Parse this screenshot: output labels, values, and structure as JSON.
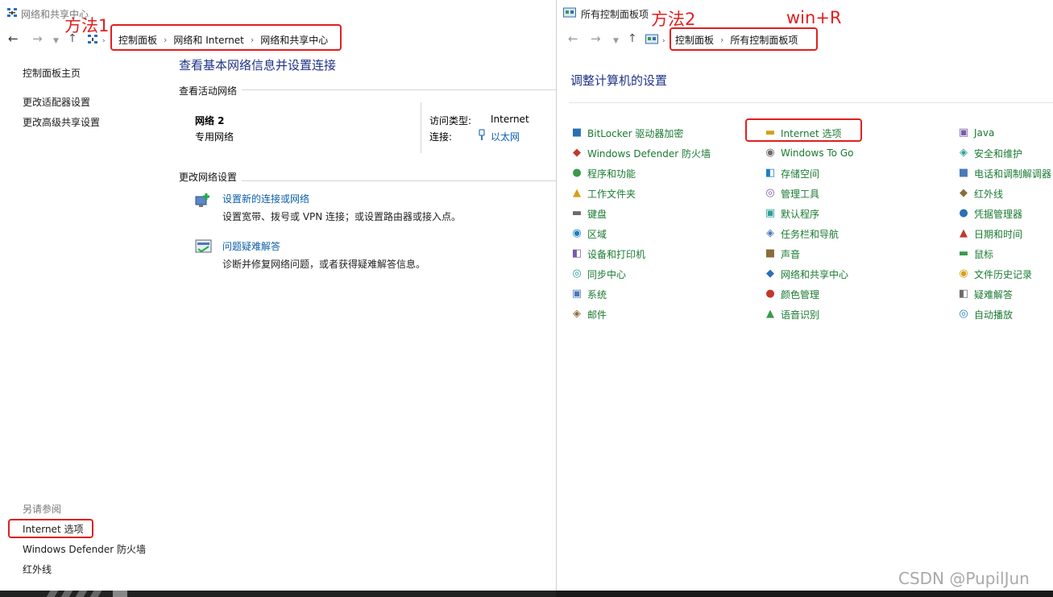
{
  "left_window": {
    "title": "网络和共享中心",
    "breadcrumb": [
      "控制面板",
      "网络和 Internet",
      "网络和共享中心"
    ],
    "annotation": "方法1",
    "sidebar": {
      "home": "控制面板主页",
      "links": [
        "更改适配器设置",
        "更改高级共享设置"
      ],
      "see_also_label": "另请参阅",
      "see_also": [
        "Internet 选项",
        "Windows Defender 防火墙",
        "红外线"
      ]
    },
    "main": {
      "heading": "查看基本网络信息并设置连接",
      "active_section": "查看活动网络",
      "network_name": "网络 2",
      "network_type": "专用网络",
      "access_type_label": "访问类型:",
      "access_type_value": "Internet",
      "connection_label": "连接:",
      "connection_value": "以太网",
      "change_section": "更改网络设置",
      "tasks": [
        {
          "title": "设置新的连接或网络",
          "desc": "设置宽带、拨号或 VPN 连接；或设置路由器或接入点。"
        },
        {
          "title": "问题疑难解答",
          "desc": "诊断并修复网络问题，或者获得疑难解答信息。"
        }
      ]
    }
  },
  "right_window": {
    "title": "所有控制面板项",
    "breadcrumb": [
      "控制面板",
      "所有控制面板项"
    ],
    "annotation": "方法2",
    "annotation_keys": "win+R",
    "heading": "调整计算机的设置",
    "columns": [
      [
        "BitLocker 驱动器加密",
        "Windows Defender 防火墙",
        "程序和功能",
        "工作文件夹",
        "键盘",
        "区域",
        "设备和打印机",
        "同步中心",
        "系统",
        "邮件"
      ],
      [
        "Internet 选项",
        "Windows To Go",
        "存储空间",
        "管理工具",
        "默认程序",
        "任务栏和导航",
        "声音",
        "网络和共享中心",
        "颜色管理",
        "语音识别"
      ],
      [
        "Java",
        "安全和维护",
        "电话和调制解调器",
        "红外线",
        "凭据管理器",
        "日期和时间",
        "鼠标",
        "文件历史记录",
        "疑难解答",
        "自动播放"
      ]
    ]
  },
  "watermark": "CSDN @PupilJun",
  "colors": {
    "annotation_red": "#e02020",
    "link_blue": "#0c5fa8",
    "heading_blue": "#1e3287",
    "cp_green": "#1a7a32"
  }
}
